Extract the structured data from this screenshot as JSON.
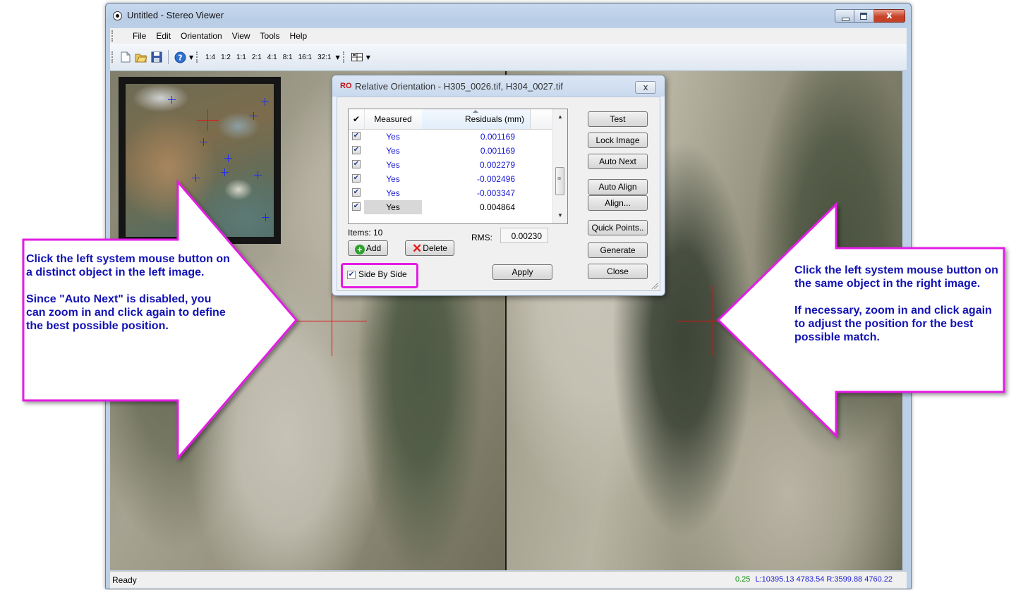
{
  "window": {
    "title": "Untitled - Stereo Viewer",
    "close_glyph": "x"
  },
  "menu": [
    "File",
    "Edit",
    "Orientation",
    "View",
    "Tools",
    "Help"
  ],
  "toolbar": {
    "icons": [
      "new-file-icon",
      "open-folder-icon",
      "save-icon",
      "help-icon"
    ],
    "zoom_levels": [
      "1:4",
      "1:2",
      "1:1",
      "2:1",
      "4:1",
      "8:1",
      "16:1",
      "32:1"
    ]
  },
  "dialog": {
    "badge": "RO",
    "title": "Relative Orientation - H305_0026.tif, H304_0027.tif",
    "close_glyph": "x",
    "table": {
      "headers": [
        "✔",
        "Measured",
        "Residuals (mm)"
      ],
      "rows": [
        {
          "checked": true,
          "measured": "Yes",
          "residual": "0.001169"
        },
        {
          "checked": true,
          "measured": "Yes",
          "residual": "0.001169"
        },
        {
          "checked": true,
          "measured": "Yes",
          "residual": "0.002279"
        },
        {
          "checked": true,
          "measured": "Yes",
          "residual": "-0.002496"
        },
        {
          "checked": true,
          "measured": "Yes",
          "residual": "-0.003347"
        },
        {
          "checked": true,
          "measured": "Yes",
          "residual": "0.004864"
        }
      ]
    },
    "items_label": "Items: 10",
    "rms_label": "RMS:",
    "rms_value": "0.00230",
    "add_label": "Add",
    "delete_label": "Delete",
    "side_by_side_label": "Side By Side",
    "side_by_side_checked": true,
    "apply_label": "Apply",
    "right_buttons": [
      "Test",
      "Lock Image",
      "Auto Next",
      "Auto Align",
      "Align...",
      "Quick Points..",
      "Generate",
      "Close"
    ]
  },
  "status": {
    "ready": "Ready",
    "zoom": "0.25",
    "coords": "L:10395.13 4783.54 R:3599.88 4760.22"
  },
  "callouts": {
    "left": "Click the left system mouse button on a distinct object in the left image.\n\nSince \"Auto Next\" is disabled, you can zoom in and click again to define the best possible position.",
    "right": "Click the left system mouse button on the same object in the right image.\n\nIf necessary, zoom in and click again to adjust the position for the best possible match."
  },
  "colors": {
    "callout_border": "#e41ce4",
    "callout_text": "#1212b4",
    "crosshair": "#e01010",
    "marker": "#1b2cff"
  }
}
